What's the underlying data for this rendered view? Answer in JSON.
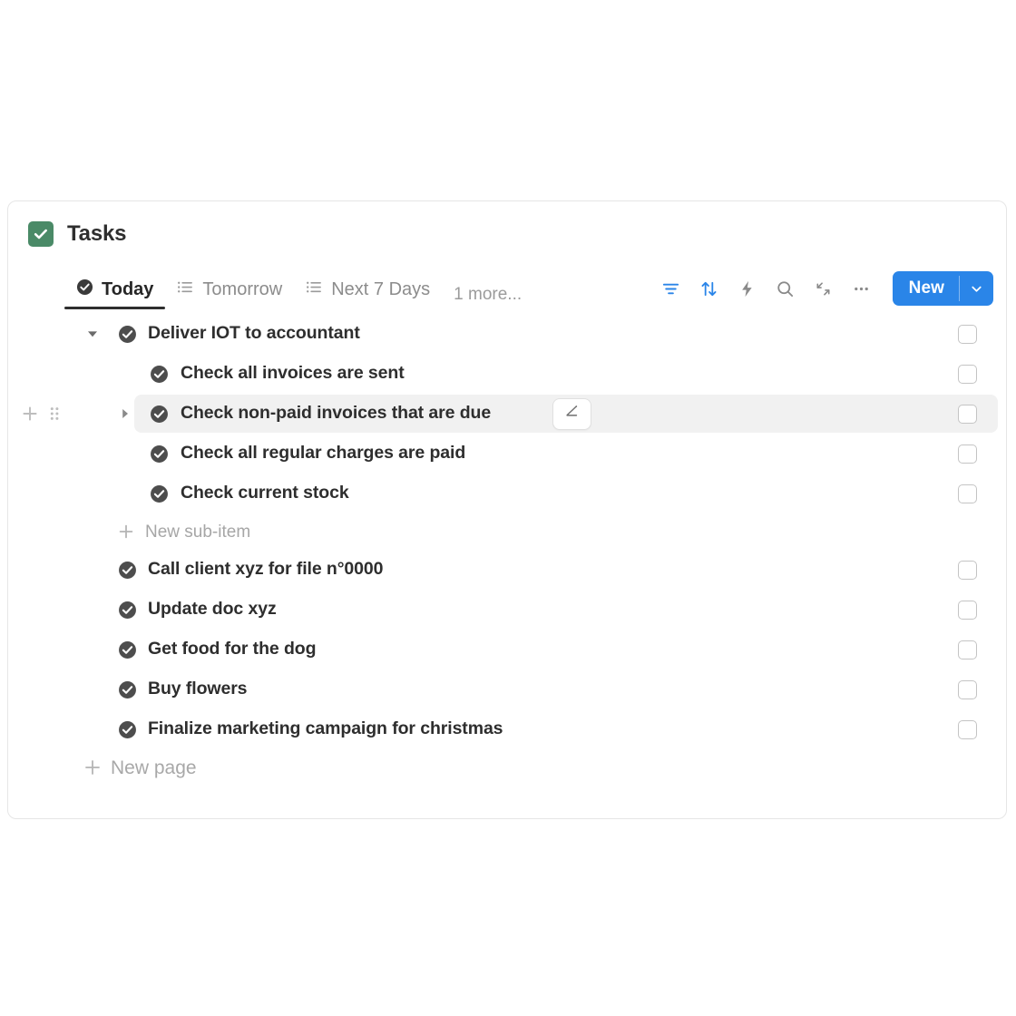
{
  "app": {
    "badge_icon": "check-square-icon",
    "title": "Tasks",
    "brand_green": "#4a8a67",
    "accent_blue": "#2a85e8"
  },
  "tabs": [
    {
      "label": "Today",
      "icon": "check-circle-icon",
      "active": true
    },
    {
      "label": "Tomorrow",
      "icon": "list-icon",
      "active": false
    },
    {
      "label": "Next 7 Days",
      "icon": "list-icon",
      "active": false
    }
  ],
  "tabs_overflow": {
    "label": "1 more..."
  },
  "toolbar": {
    "filter": {
      "icon": "filter-icon",
      "color": "#2a85e8"
    },
    "sort": {
      "icon": "sort-arrows-icon",
      "color": "#2a85e8"
    },
    "automation": {
      "icon": "lightning-bolt-icon",
      "color": "#8a8a8a"
    },
    "search": {
      "icon": "search-icon",
      "color": "#8a8a8a"
    },
    "expand": {
      "icon": "expand-diagonal-icon",
      "color": "#8a8a8a"
    },
    "more": {
      "icon": "ellipsis-icon",
      "color": "#8a8a8a"
    },
    "new_button": {
      "label": "New",
      "caret_icon": "chevron-down-icon"
    }
  },
  "rows": [
    {
      "label": "Deliver IOT to accountant",
      "level": 0,
      "caret": "triangle-down-icon",
      "status_icon": "check-circle-icon",
      "checked": false,
      "hovered": false
    },
    {
      "label": "Check all invoices are sent",
      "level": 1,
      "caret": "",
      "status_icon": "check-circle-icon",
      "checked": false,
      "hovered": false
    },
    {
      "label": "Check non-paid invoices that are due",
      "level": 1,
      "caret": "triangle-right-icon",
      "status_icon": "check-circle-icon",
      "checked": false,
      "hovered": true,
      "edit_icon": "pencil-edit-icon",
      "gutter": [
        "plus-icon",
        "drag-handle-icon"
      ]
    },
    {
      "label": "Check all regular charges are paid",
      "level": 1,
      "caret": "",
      "status_icon": "check-circle-icon",
      "checked": false,
      "hovered": false
    },
    {
      "label": "Check current stock",
      "level": 1,
      "caret": "",
      "status_icon": "check-circle-icon",
      "checked": false,
      "hovered": false
    }
  ],
  "sub_add": {
    "label": "New sub-item",
    "icon": "plus-icon"
  },
  "rows_bottom": [
    {
      "label": "Call client xyz for file n°0000",
      "status_icon": "check-circle-icon",
      "checked": false
    },
    {
      "label": "Update doc xyz",
      "status_icon": "check-circle-icon",
      "checked": false
    },
    {
      "label": "Get food for the dog",
      "status_icon": "check-circle-icon",
      "checked": false
    },
    {
      "label": "Buy flowers",
      "status_icon": "check-circle-icon",
      "checked": false
    },
    {
      "label": "Finalize marketing campaign for christmas",
      "status_icon": "check-circle-icon",
      "checked": false
    }
  ],
  "page_add": {
    "label": "New page",
    "icon": "plus-icon"
  }
}
